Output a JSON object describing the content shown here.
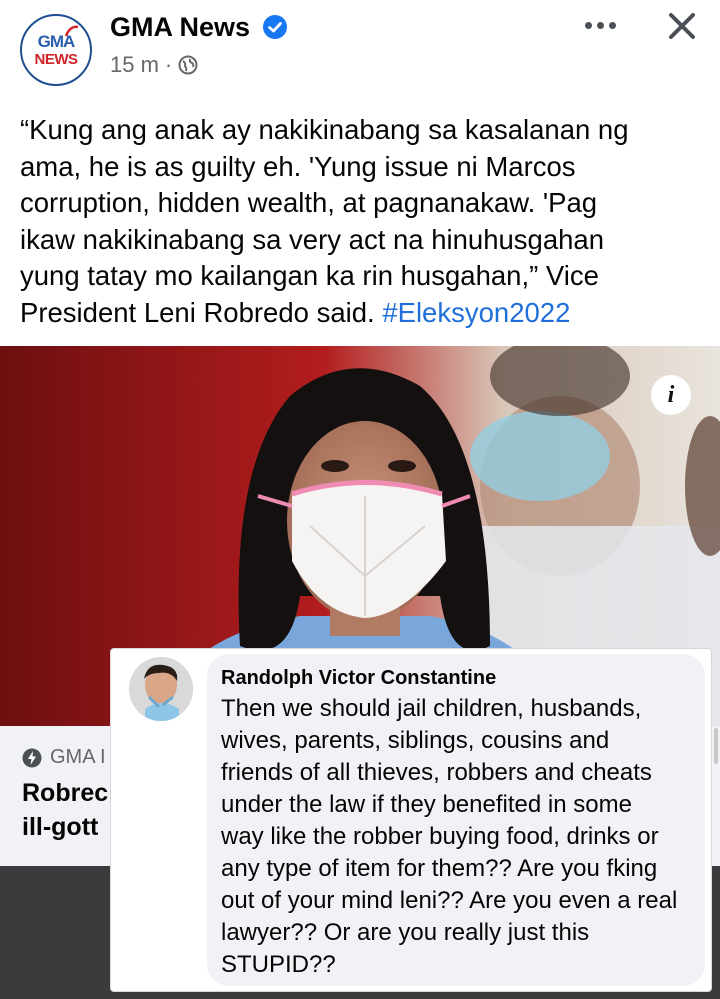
{
  "post": {
    "page_name": "GMA News",
    "logo_text_top": "GMA",
    "logo_text_bottom": "NEWS",
    "timestamp": "15 m",
    "separator": "·",
    "privacy_icon": "globe-icon",
    "text_lines": [
      "“Kung ang anak ay nakikinabang sa kasalanan ng",
      "ama, he is as guilty eh. 'Yung issue ni Marcos",
      "corruption, hidden wealth, at pagnanakaw. 'Pag",
      "ikaw nakikinabang sa very act na hinuhusgahan",
      "yung tatay mo kailangan ka rin husgahan,” Vice"
    ],
    "text_last_line": "President Leni Robredo said.",
    "hashtag": "#Eleksyon2022"
  },
  "photo": {
    "info_label": "i"
  },
  "link_preview": {
    "source": "GMA I",
    "title_lines": [
      "Robrec",
      "ill-gott"
    ]
  },
  "comment": {
    "author": "Randolph Victor Constantine",
    "text_lines": [
      "Then we should jail children, husbands,",
      "wives, parents, siblings, cousins and",
      "friends of all thieves, robbers and cheats",
      "under the law if they benefited in some",
      "way like the robber buying food, drinks or",
      "any type of item for them?? Are you fking",
      "out of your mind leni?? Are you even a real",
      "lawyer?? Or are you really just this",
      "STUPID??"
    ]
  },
  "colors": {
    "hashtag": "#216fdb",
    "verified": "#1877f2",
    "link_bg": "#f0f2f5",
    "bottom_bar": "#3a3b3d"
  }
}
